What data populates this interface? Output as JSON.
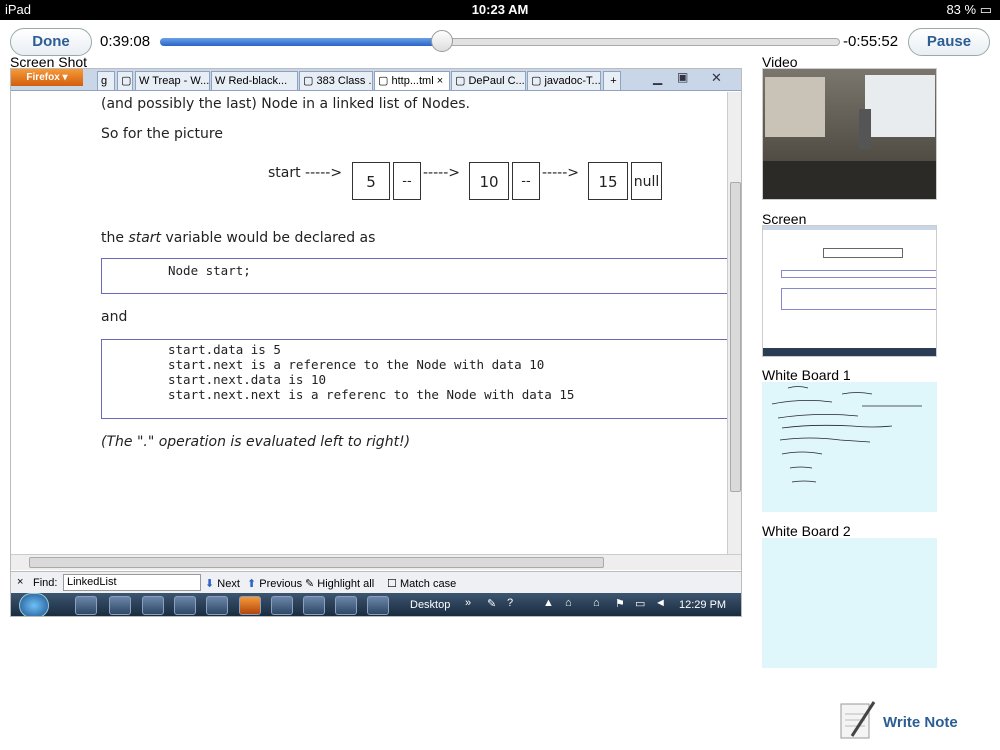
{
  "status": {
    "device": "iPad",
    "time": "10:23 AM",
    "battery": "83 %"
  },
  "player": {
    "done_label": "Done",
    "elapsed": "0:39:08",
    "remaining": "-0:55:52",
    "pause_label": "Pause",
    "progress_fraction": 0.415
  },
  "captions": {
    "screenshot": "Screen Shot",
    "video": "Video",
    "screen": "Screen",
    "wb1": "White Board 1",
    "wb2": "White Board 2"
  },
  "browser": {
    "firefox_label": "Firefox",
    "tabs": [
      "Treap - W...",
      "Red-black...",
      "383 Class ...",
      "http...tml",
      "DePaul C...",
      "javadoc-T..."
    ],
    "new_tab": "+"
  },
  "doc": {
    "line1": "(and possibly the last) Node in a linked list of Nodes.",
    "line2": "So for the picture",
    "start_label": "start ----->",
    "arrow": "----->",
    "dash": "--",
    "nodes": [
      "5",
      "10",
      "15"
    ],
    "null_label": "null",
    "declared_pre": "the ",
    "declared_em": "start",
    "declared_post": " variable would be declared as",
    "code1": "Node start;",
    "and_label": "and",
    "code2": [
      "start.data is 5",
      "start.next is a reference to the Node with data 10",
      "start.next.data is 10",
      "start.next.next is a referenc to the Node with data 15"
    ],
    "note": "(The \".\" operation is evaluated left to right!)"
  },
  "findbar": {
    "close": "×",
    "find_label": "Find:",
    "value": "LinkedList",
    "next": "Next",
    "previous": "Previous",
    "highlight": "Highlight all",
    "match": "Match case"
  },
  "taskbar": {
    "desktop": "Desktop",
    "time": "12:29 PM"
  },
  "note_button": "Write Note"
}
